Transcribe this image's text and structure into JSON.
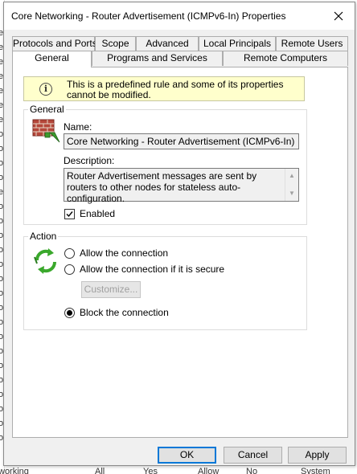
{
  "dialog": {
    "title": "Core Networking - Router Advertisement (ICMPv6-In) Properties"
  },
  "tabs": {
    "row1": [
      "Protocols and Ports",
      "Scope",
      "Advanced",
      "Local Principals",
      "Remote Users"
    ],
    "row2": [
      "General",
      "Programs and Services",
      "Remote Computers"
    ],
    "active": "General"
  },
  "info": {
    "icon": "info-icon",
    "text": "This is a predefined rule and some of its properties cannot be modified."
  },
  "general_group": {
    "label": "General",
    "icon": "firewall-rule-icon",
    "name_label": "Name:",
    "name_value": "Core Networking - Router Advertisement (ICMPv6-In)",
    "description_label": "Description:",
    "description_value": "Router Advertisement messages are sent by routers to other nodes for stateless auto-configuration.",
    "enabled_label": "Enabled",
    "enabled": true
  },
  "action_group": {
    "label": "Action",
    "icon": "action-arrows-icon",
    "options": [
      {
        "label": "Allow the connection",
        "selected": false
      },
      {
        "label": "Allow the connection if it is secure",
        "selected": false
      },
      {
        "label": "Block the connection",
        "selected": true
      }
    ],
    "customize_label": "Customize..."
  },
  "buttons": {
    "ok": "OK",
    "cancel": "Cancel",
    "apply": "Apply"
  },
  "background": {
    "left_strip": [
      "ev",
      "ev",
      "ev",
      "ev",
      "ev",
      "ev",
      "ev",
      "o",
      "o",
      "o",
      "o",
      "et",
      "o",
      "o",
      "o",
      "o",
      "o",
      "o",
      "o",
      "o",
      "o",
      "o",
      "o",
      "o",
      "o",
      "o",
      "o",
      "o",
      "o"
    ],
    "bottom_row": [
      "working",
      "All",
      "Yes",
      "Allow",
      "No",
      "System"
    ]
  },
  "colors": {
    "accent": "#0078d7",
    "info_background": "#ffffcc",
    "dialog_background": "#f0f0f0"
  }
}
